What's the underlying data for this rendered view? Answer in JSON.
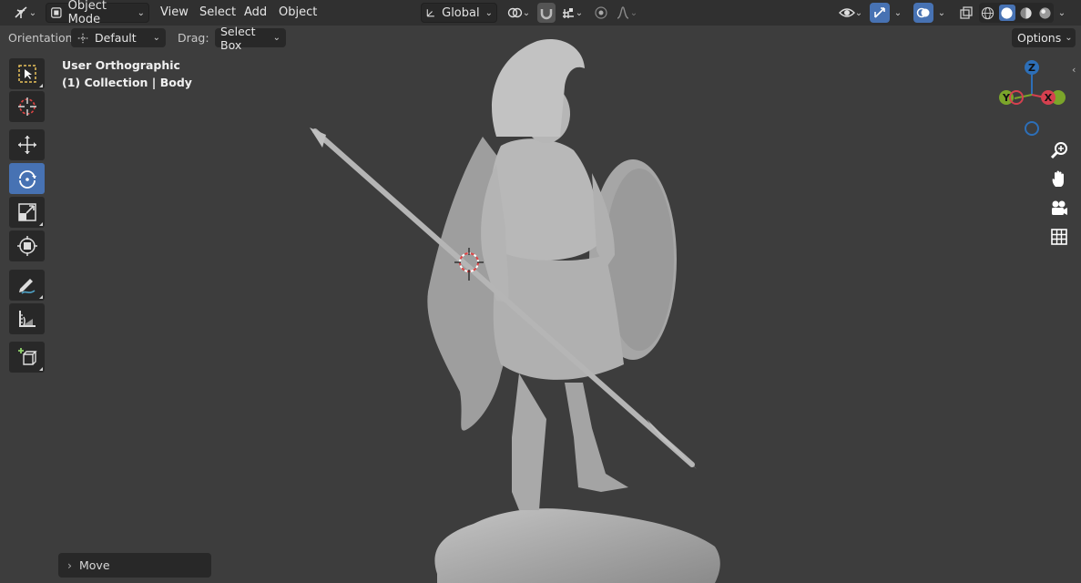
{
  "header": {
    "mode": "Object Mode",
    "menus": [
      "View",
      "Select",
      "Add",
      "Object"
    ],
    "transform_orientation": "Global"
  },
  "tool_settings": {
    "orientation_label": "Orientation:",
    "orientation_value": "Default",
    "drag_label": "Drag:",
    "drag_value": "Select Box",
    "options_label": "Options"
  },
  "viewport": {
    "view_name": "User Orthographic",
    "collection_info": "(1) Collection | Body",
    "background_color": "#3d3d3d",
    "model_color": "#a8a8a8"
  },
  "toolbar": {
    "tools": [
      {
        "name": "select-box",
        "icon": "select-box-icon",
        "active": false
      },
      {
        "name": "cursor",
        "icon": "cursor-icon",
        "active": false
      },
      {
        "name": "move",
        "icon": "move-icon",
        "active": false
      },
      {
        "name": "rotate",
        "icon": "rotate-icon",
        "active": true
      },
      {
        "name": "scale",
        "icon": "scale-icon",
        "active": false
      },
      {
        "name": "transform",
        "icon": "transform-icon",
        "active": false
      },
      {
        "name": "annotate",
        "icon": "annotate-icon",
        "active": false
      },
      {
        "name": "measure",
        "icon": "measure-icon",
        "active": false
      },
      {
        "name": "add-cube",
        "icon": "add-cube-icon",
        "active": false
      }
    ],
    "accent_color": "#4772b3"
  },
  "gizmo": {
    "z_label": "Z",
    "y_label": "Y",
    "x_label": "X",
    "colors": {
      "x": "#d5404f",
      "y": "#7ba52a",
      "z": "#2d6fb8"
    }
  },
  "navigation": {
    "buttons": [
      "zoom-icon",
      "hand-pan-icon",
      "camera-icon",
      "grid-icon"
    ]
  },
  "last_operator": {
    "label": "Move"
  }
}
